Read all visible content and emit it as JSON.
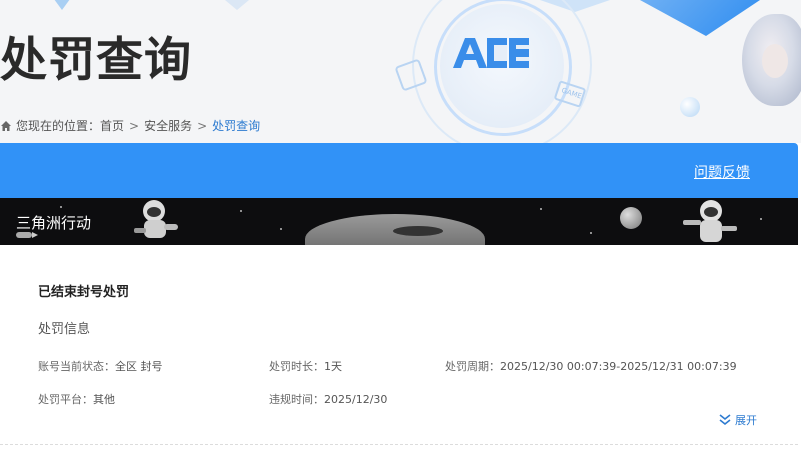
{
  "header": {
    "title": "处罚查询",
    "logo_text": "ACE",
    "game_badge_text": "GAME"
  },
  "breadcrumb": {
    "prefix": "您现在的位置：",
    "items": [
      "首页",
      "安全服务",
      "处罚查询"
    ],
    "separator": ">"
  },
  "toolbar": {
    "feedback_label": "问题反馈"
  },
  "banner": {
    "game_name": "三角洲行动"
  },
  "record": {
    "status_title": "已结束封号处罚",
    "section_title": "处罚信息",
    "fields": {
      "account_status": {
        "label": "账号当前状态：",
        "value": "全区 封号"
      },
      "duration": {
        "label": "处罚时长：",
        "value": "1天"
      },
      "period": {
        "label": "处罚周期：",
        "value": "2025/12/30 00:07:39-2025/12/31 00:07:39"
      },
      "platform": {
        "label": "处罚平台：",
        "value": "其他"
      },
      "violation_time": {
        "label": "违规时间：",
        "value": "2025/12/30"
      }
    },
    "expand_label": "展开"
  },
  "colors": {
    "accent_blue": "#3192f7",
    "link_blue": "#2d7bd0",
    "banner_bg": "#0d0d0f"
  },
  "icons": [
    "home-icon",
    "chevron-down-double-icon"
  ]
}
